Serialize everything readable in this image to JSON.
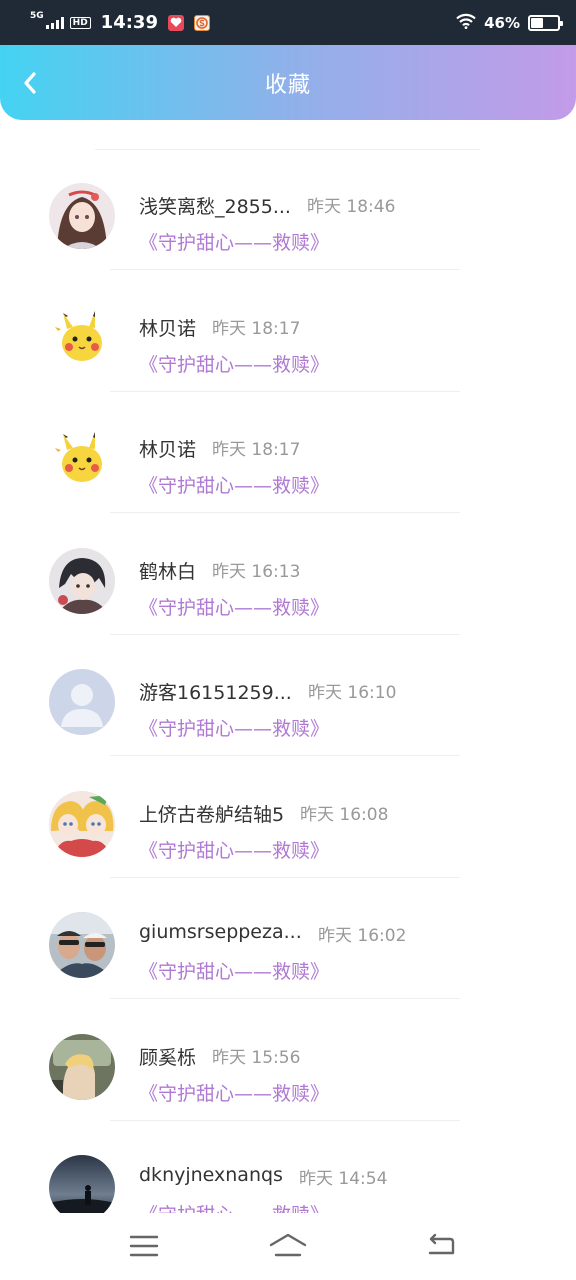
{
  "status_bar": {
    "network": "5G",
    "hd": "HD",
    "time": "14:39",
    "battery_percent": "46%",
    "battery_level": 0.46,
    "icons": [
      "signal-icon",
      "hd-icon",
      "app-heart-icon",
      "app-s-icon",
      "wifi-icon",
      "battery-icon"
    ]
  },
  "header": {
    "title": "收藏",
    "back_icon": "chevron-left-icon",
    "colors": {
      "start": "#44d3f2",
      "end": "#c39be8"
    }
  },
  "list": {
    "accent_color": "#b07ad4",
    "items": [
      {
        "name": "浅笑离愁_2855...",
        "time": "昨天 18:46",
        "book": "《守护甜心——救赎》",
        "avatar": "anime-girl-avatar"
      },
      {
        "name": "林贝诺",
        "time": "昨天 18:17",
        "book": "《守护甜心——救赎》",
        "avatar": "pikachu-avatar"
      },
      {
        "name": "林贝诺",
        "time": "昨天 18:17",
        "book": "《守护甜心——救赎》",
        "avatar": "pikachu-avatar"
      },
      {
        "name": "鹤林白",
        "time": "昨天 16:13",
        "book": "《守护甜心——救赎》",
        "avatar": "anime-boy-avatar"
      },
      {
        "name": "游客16151259...",
        "time": "昨天 16:10",
        "book": "《守护甜心——救赎》",
        "avatar": "default-user-avatar"
      },
      {
        "name": "上侪古卷舻结轴5",
        "time": "昨天 16:08",
        "book": "《守护甜心——救赎》",
        "avatar": "anime-twins-avatar"
      },
      {
        "name": "giumsrseppeza...",
        "time": "昨天 16:02",
        "book": "《守护甜心——救赎》",
        "avatar": "photo-men-avatar"
      },
      {
        "name": "顾奚栎",
        "time": "昨天 15:56",
        "book": "《守护甜心——救赎》",
        "avatar": "photo-car-avatar"
      },
      {
        "name": "dknyjnexnanqs",
        "time": "昨天 14:54",
        "book": "《守护甜心——救赎》",
        "avatar": "photo-night-avatar"
      }
    ]
  },
  "nav": {
    "icons": [
      "menu-icon",
      "home-icon",
      "back-icon"
    ]
  }
}
